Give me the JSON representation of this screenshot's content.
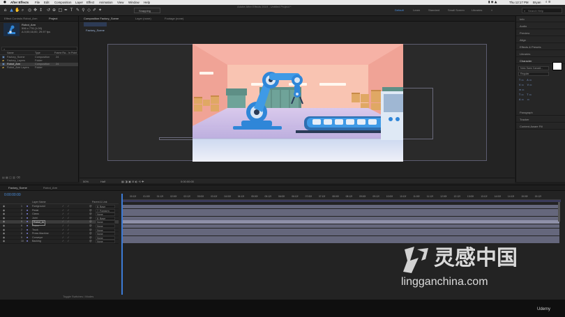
{
  "menubar": {
    "app": "After Effects",
    "items": [
      "File",
      "Edit",
      "Composition",
      "Layer",
      "Effect",
      "Animation",
      "View",
      "Window",
      "Help"
    ],
    "window_title": "Adobe After Effects 2019 - Untitled Project *",
    "clock": "Thu 12:17 PM",
    "user": "Bryan"
  },
  "toolbar": {
    "snapping_label": "Snapping",
    "workspaces": [
      "Default",
      "Learn",
      "Standard",
      "Small Screen",
      "Libraries"
    ],
    "search_placeholder": "Search Help"
  },
  "project": {
    "tabs": [
      "Effect Controls Robot_Arm",
      "Project"
    ],
    "selected_name": "Robot_Arm",
    "info_lines": [
      "used 1 time",
      "596 x 776 (1.00)",
      "Δ 0;00;16;00, 29.97 fps"
    ],
    "columns": [
      "Name",
      "Type",
      "Frame Ra...",
      "In Point"
    ],
    "rows": [
      {
        "name": "Factory_Scene",
        "type": "Composition",
        "fps": "24",
        "in": ""
      },
      {
        "name": "Factory_Layers",
        "type": "Folder",
        "fps": "",
        "in": ""
      },
      {
        "name": "Robot_Arm",
        "type": "Composition",
        "fps": "24",
        "in": ""
      },
      {
        "name": "Robot_Arm Layers",
        "type": "Folder",
        "fps": "",
        "in": ""
      }
    ]
  },
  "viewer": {
    "tabs": [
      "Composition Factory_Scene",
      "Layer (none)",
      "Footage (none)"
    ],
    "breadcrumb": "Factory_Scene",
    "zoom": "50%",
    "quality": "Half",
    "timecode": "0:00:00:00"
  },
  "right_panel": {
    "items": [
      "Info",
      "Audio",
      "Preview",
      "Align",
      "Effects & Presets",
      "Libraries",
      "Character",
      "Paragraph",
      "Tracker",
      "Content-Aware Fill"
    ],
    "font_name": "Noto Sans Canadi...",
    "font_style": "Regular"
  },
  "timeline": {
    "tabs": [
      "Factory_Scene",
      "Robot_Arm"
    ],
    "timecode": "0:00:00:00",
    "header_cols": [
      "Layer Name",
      "Parent & Link"
    ],
    "layers": [
      {
        "num": "1",
        "name": "Foreground",
        "parent": "8. Base"
      },
      {
        "num": "2",
        "name": "Pedal",
        "parent": "7. Forearm"
      },
      {
        "num": "3",
        "name": "Claws",
        "parent": "None"
      },
      {
        "num": "4",
        "name": "Joint",
        "parent": "8. Base"
      },
      {
        "num": "5",
        "name": "Robot_Ar",
        "parent": "None"
      },
      {
        "num": "6",
        "name": "Piston",
        "parent": "None"
      },
      {
        "num": "7",
        "name": "Truck",
        "parent": "None"
      },
      {
        "num": "8",
        "name": "Press Machine",
        "parent": "None"
      },
      {
        "num": "9",
        "name": "Conveyor",
        "parent": "None"
      },
      {
        "num": "10",
        "name": "Backing",
        "parent": "None"
      }
    ],
    "selected_layer_index": 4,
    "ruler_labels": [
      "00:12f",
      "01:00f",
      "01:12f",
      "02:00f",
      "02:12f",
      "03:00f",
      "03:12f",
      "04:00f",
      "04:12f",
      "05:00f",
      "05:12f",
      "06:00f",
      "06:12f",
      "07:00f",
      "07:12f",
      "08:00f",
      "08:12f",
      "09:00f",
      "09:12f",
      "10:00f",
      "10:12f",
      "11:00f",
      "11:12f",
      "12:00f",
      "12:12f",
      "13:00f",
      "13:12f",
      "14:00f",
      "14:12f",
      "15:00f",
      "15:12f"
    ],
    "footer": "Toggle Switches / Modes"
  },
  "watermark": {
    "cn_text": "灵感中国",
    "url": "lingganchina.com",
    "udemy": "Udemy"
  },
  "colors": {
    "accent": "#4a90e2",
    "playhead": "#3c7bd6",
    "layer_bar": "#65677c",
    "robot_blue": "#2f86d8"
  }
}
